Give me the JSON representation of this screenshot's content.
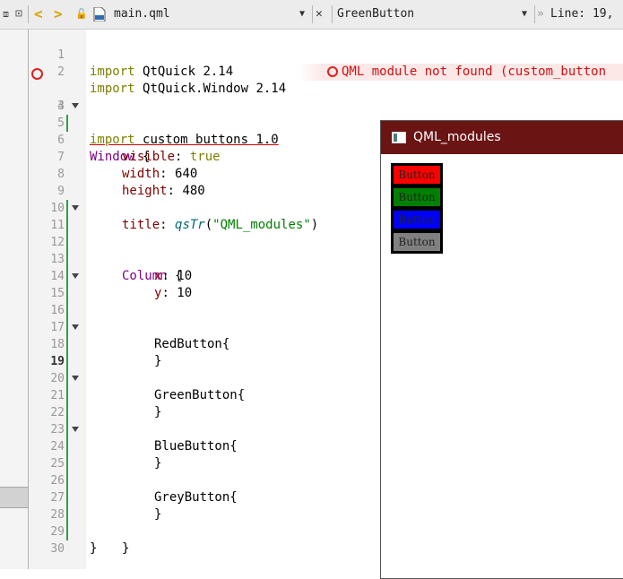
{
  "toolbar": {
    "back_icon": "chevron-left-icon",
    "forward_icon": "chevron-right-icon",
    "file_name": "main.qml",
    "file_dropdown_icon": "chevron-down-icon",
    "close_icon": "close-icon",
    "symbol_name": "GreenButton",
    "symbol_dropdown_icon": "chevron-down-icon",
    "position_label": "Line: 19,"
  },
  "editor": {
    "current_line": "19",
    "lines": [
      {
        "num": "1"
      },
      {
        "num": "2"
      },
      {
        "num": "3"
      },
      {
        "num": "4"
      },
      {
        "num": "5"
      },
      {
        "num": "6"
      },
      {
        "num": "7"
      },
      {
        "num": "8"
      },
      {
        "num": "9"
      },
      {
        "num": "10"
      },
      {
        "num": "11"
      },
      {
        "num": "12"
      },
      {
        "num": "13"
      },
      {
        "num": "14"
      },
      {
        "num": "15"
      },
      {
        "num": "16"
      },
      {
        "num": "17"
      },
      {
        "num": "18"
      },
      {
        "num": "19"
      },
      {
        "num": "20"
      },
      {
        "num": "21"
      },
      {
        "num": "22"
      },
      {
        "num": "23"
      },
      {
        "num": "24"
      },
      {
        "num": "25"
      },
      {
        "num": "26"
      },
      {
        "num": "27"
      },
      {
        "num": "28"
      },
      {
        "num": "29"
      },
      {
        "num": "30"
      }
    ],
    "tokens": {
      "import": "import",
      "qtquick": "QtQuick 2.14",
      "qtquick_window": "QtQuick.Window 2.14",
      "custom_buttons": "custom buttons 1.0",
      "window": "Window",
      "open_brace": " {",
      "close_brace": "}",
      "visible": "visible",
      "true_val": "true",
      "width": "width",
      "width_val": "640",
      "height": "height",
      "height_val": "480",
      "title": "title",
      "qstr_fn": "qsTr",
      "qstr_arg": "\"QML_modules\"",
      "column": "Column",
      "x": "x",
      "x_val": "10",
      "y": "y",
      "y_val": "10",
      "red_button": "RedButton{",
      "green_button": "GreenButton{",
      "blue_button": "BlueButton{",
      "grey_button": "GreyButton{"
    },
    "error_message": "QML module not found (custom_button"
  },
  "preview": {
    "title": "QML_modules",
    "buttons": [
      {
        "label": "Button",
        "color": "#ff0000"
      },
      {
        "label": "Button",
        "color": "#008000"
      },
      {
        "label": "Button",
        "color": "#0000ff"
      },
      {
        "label": "Button",
        "color": "#808080"
      }
    ]
  }
}
